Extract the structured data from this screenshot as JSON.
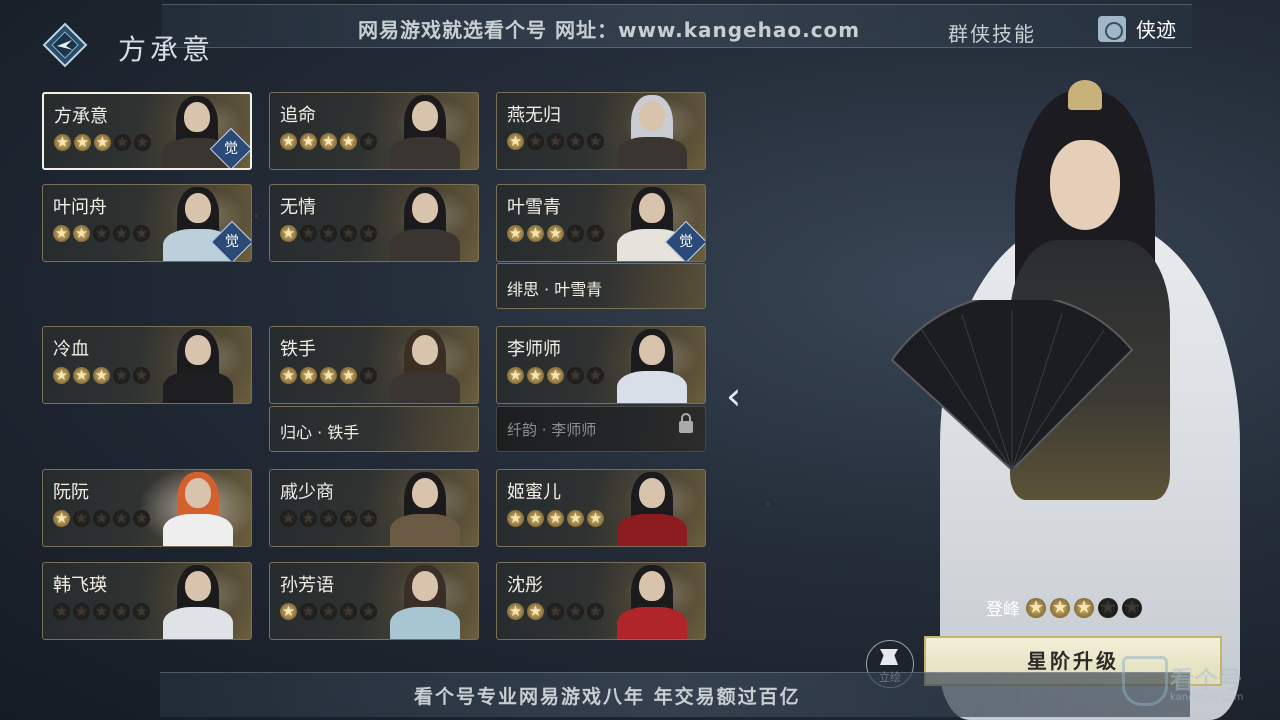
{
  "header": {
    "title": "方承意",
    "watermark": "网易游戏就选看个号  网址：www.kangehao.com",
    "tab_skill": "群侠技能",
    "tab_deeds": "侠迹"
  },
  "heroes": [
    {
      "name": "方承意",
      "stars": 3,
      "awakened": true,
      "selected": true
    },
    {
      "name": "追命",
      "stars": 4,
      "awakened": false
    },
    {
      "name": "燕无归",
      "stars": 1,
      "awakened": false
    },
    {
      "name": "叶问舟",
      "stars": 2,
      "awakened": true
    },
    {
      "name": "无情",
      "stars": 1,
      "awakened": false
    },
    {
      "name": "叶雪青",
      "stars": 3,
      "awakened": true
    },
    {
      "name": "冷血",
      "stars": 3,
      "awakened": false
    },
    {
      "name": "铁手",
      "stars": 4,
      "awakened": false
    },
    {
      "name": "李师师",
      "stars": 3,
      "awakened": false
    },
    {
      "name": "阮阮",
      "stars": 1,
      "awakened": false
    },
    {
      "name": "戚少商",
      "stars": 0,
      "awakened": false
    },
    {
      "name": "姬蜜儿",
      "stars": 5,
      "awakened": false
    },
    {
      "name": "韩飞瑛",
      "stars": 0,
      "awakened": false
    },
    {
      "name": "孙芳语",
      "stars": 1,
      "awakened": false
    },
    {
      "name": "沈彤",
      "stars": 2,
      "awakened": false
    }
  ],
  "skins": [
    {
      "name": "绯思 · 叶雪青",
      "locked": false
    },
    {
      "name": "归心 · 铁手",
      "locked": false
    },
    {
      "name": "纤韵 · 李师师",
      "locked": true
    }
  ],
  "badge_awaken": "觉",
  "detail": {
    "rank_label": "登峰",
    "rank_stars": 3,
    "upgrade_button": "星阶升级",
    "portrait_button": "立绘"
  },
  "footer": {
    "watermark": "看个号专业网易游戏八年  年交易额过百亿",
    "corner_brand": "看个号",
    "corner_url": "kangehao.com"
  },
  "colors": {
    "star_on": "#d9b871",
    "accent_gold": "#c4b46c",
    "awaken_badge": "#2c4a78"
  }
}
